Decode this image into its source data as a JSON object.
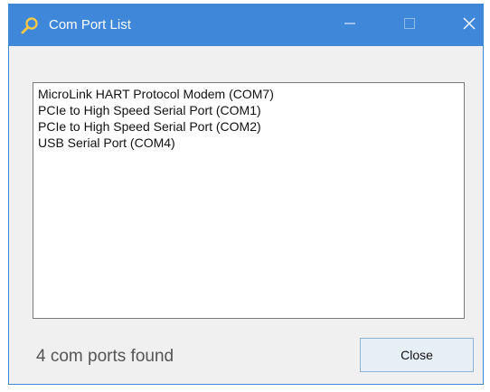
{
  "window": {
    "title": "Com Port List",
    "title_icon": "search-icon"
  },
  "titlebar_buttons": {
    "minimize_icon": "minimize-icon",
    "maximize_icon": "maximize-icon",
    "close_icon": "close-icon"
  },
  "ports": [
    "MicroLink HART Protocol Modem (COM7)",
    "PCIe to High Speed Serial Port (COM1)",
    "PCIe to High Speed Serial Port (COM2)",
    "USB Serial Port (COM4)"
  ],
  "status": "4 com ports found",
  "buttons": {
    "close_label": "Close"
  },
  "colors": {
    "titlebar": "#3f87d9",
    "background": "#f0f0f0",
    "list_background": "#ffffff",
    "button_border": "#8cb4d8"
  }
}
